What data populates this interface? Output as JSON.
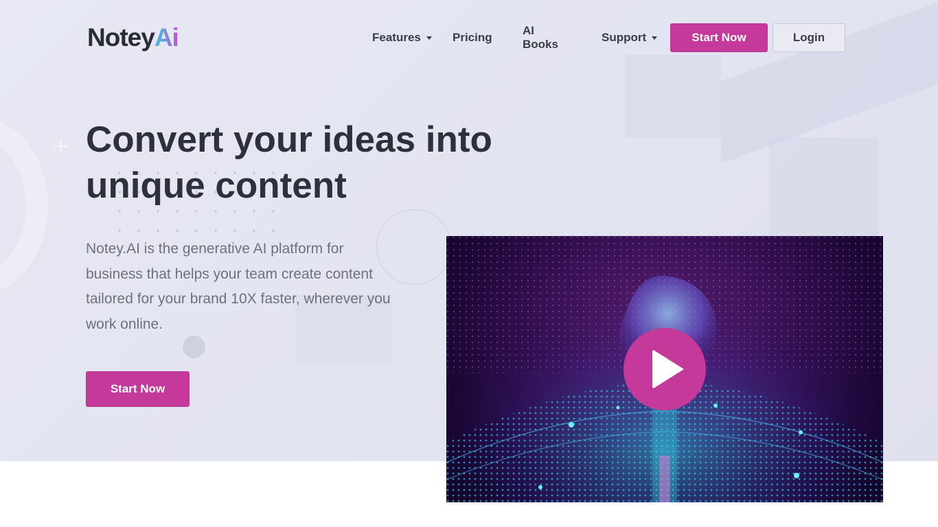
{
  "brand": {
    "name_main": "Notey",
    "name_accent": "Ai"
  },
  "nav": {
    "items": [
      {
        "label": "Features",
        "has_dropdown": true
      },
      {
        "label": "Pricing",
        "has_dropdown": false
      },
      {
        "label": "AI Books",
        "has_dropdown": false
      },
      {
        "label": "Support",
        "has_dropdown": true
      }
    ],
    "start_label": "Start Now",
    "login_label": "Login"
  },
  "hero": {
    "headline_line1": "Convert your ideas into",
    "headline_line2": "unique content",
    "description": "Notey.AI is the generative AI platform for business that helps your team create content tailored for your brand 10X faster, wherever you work online.",
    "cta_label": "Start Now"
  },
  "video": {
    "icon": "play-icon"
  },
  "colors": {
    "accent": "#c4399a",
    "text_dark": "#2e313b",
    "text_muted": "#6e717d",
    "hero_bg": "#e4e5f1"
  }
}
